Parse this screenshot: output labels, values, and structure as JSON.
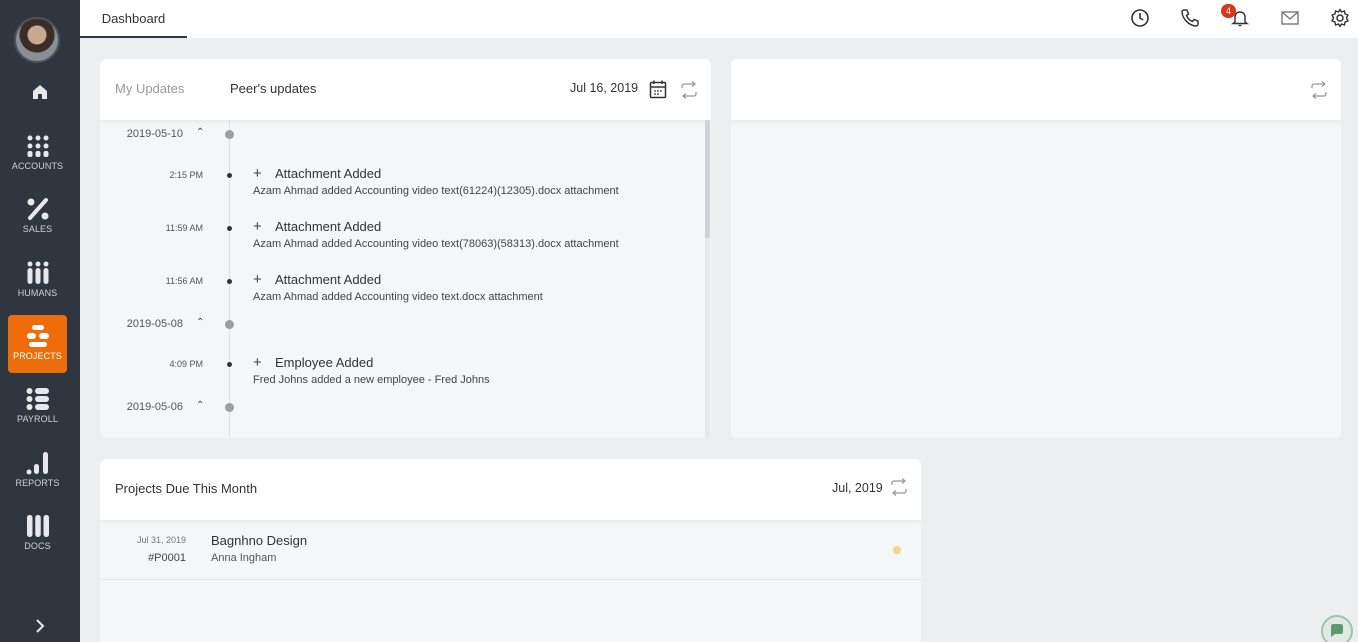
{
  "sidebar": {
    "items": [
      {
        "label": "ACCOUNTS",
        "icon": "grid-dots-icon"
      },
      {
        "label": "SALES",
        "icon": "percent-icon"
      },
      {
        "label": "HUMANS",
        "icon": "people-icon"
      },
      {
        "label": "PROJECTS",
        "icon": "projects-icon",
        "active": true
      },
      {
        "label": "PAYROLL",
        "icon": "list-icon"
      },
      {
        "label": "REPORTS",
        "icon": "bar-chart-icon"
      },
      {
        "label": "DOCS",
        "icon": "docs-icon"
      }
    ]
  },
  "topbar": {
    "tab": "Dashboard",
    "notification_count": "4"
  },
  "updates": {
    "tab_my": "My Updates",
    "tab_peer": "Peer's updates",
    "date": "Jul 16, 2019",
    "days": [
      {
        "date": "2019-05-10"
      },
      {
        "date": "2019-05-08"
      },
      {
        "date": "2019-05-06"
      }
    ],
    "events": [
      {
        "time": "2:15 PM",
        "title": "Attachment Added",
        "desc": "Azam Ahmad added Accounting video text(61224)(12305).docx attachment"
      },
      {
        "time": "11:59 AM",
        "title": "Attachment Added",
        "desc": "Azam Ahmad added Accounting video text(78063)(58313).docx attachment"
      },
      {
        "time": "11:56 AM",
        "title": "Attachment Added",
        "desc": "Azam Ahmad added Accounting video text.docx attachment"
      },
      {
        "time": "4:09 PM",
        "title": "Employee Added",
        "desc": "Fred Johns added a new employee - Fred Johns"
      }
    ]
  },
  "projects": {
    "title": "Projects Due This Month",
    "month": "Jul, 2019",
    "rows": [
      {
        "date": "Jul 31, 2019",
        "id": "#P0001",
        "name": "Bagnhno Design",
        "owner": "Anna Ingham",
        "status_color": "#f4d58d"
      }
    ]
  },
  "colors": {
    "sidebar": "#2f3640",
    "accent": "#ee6d0a",
    "badge": "#d9381e"
  }
}
